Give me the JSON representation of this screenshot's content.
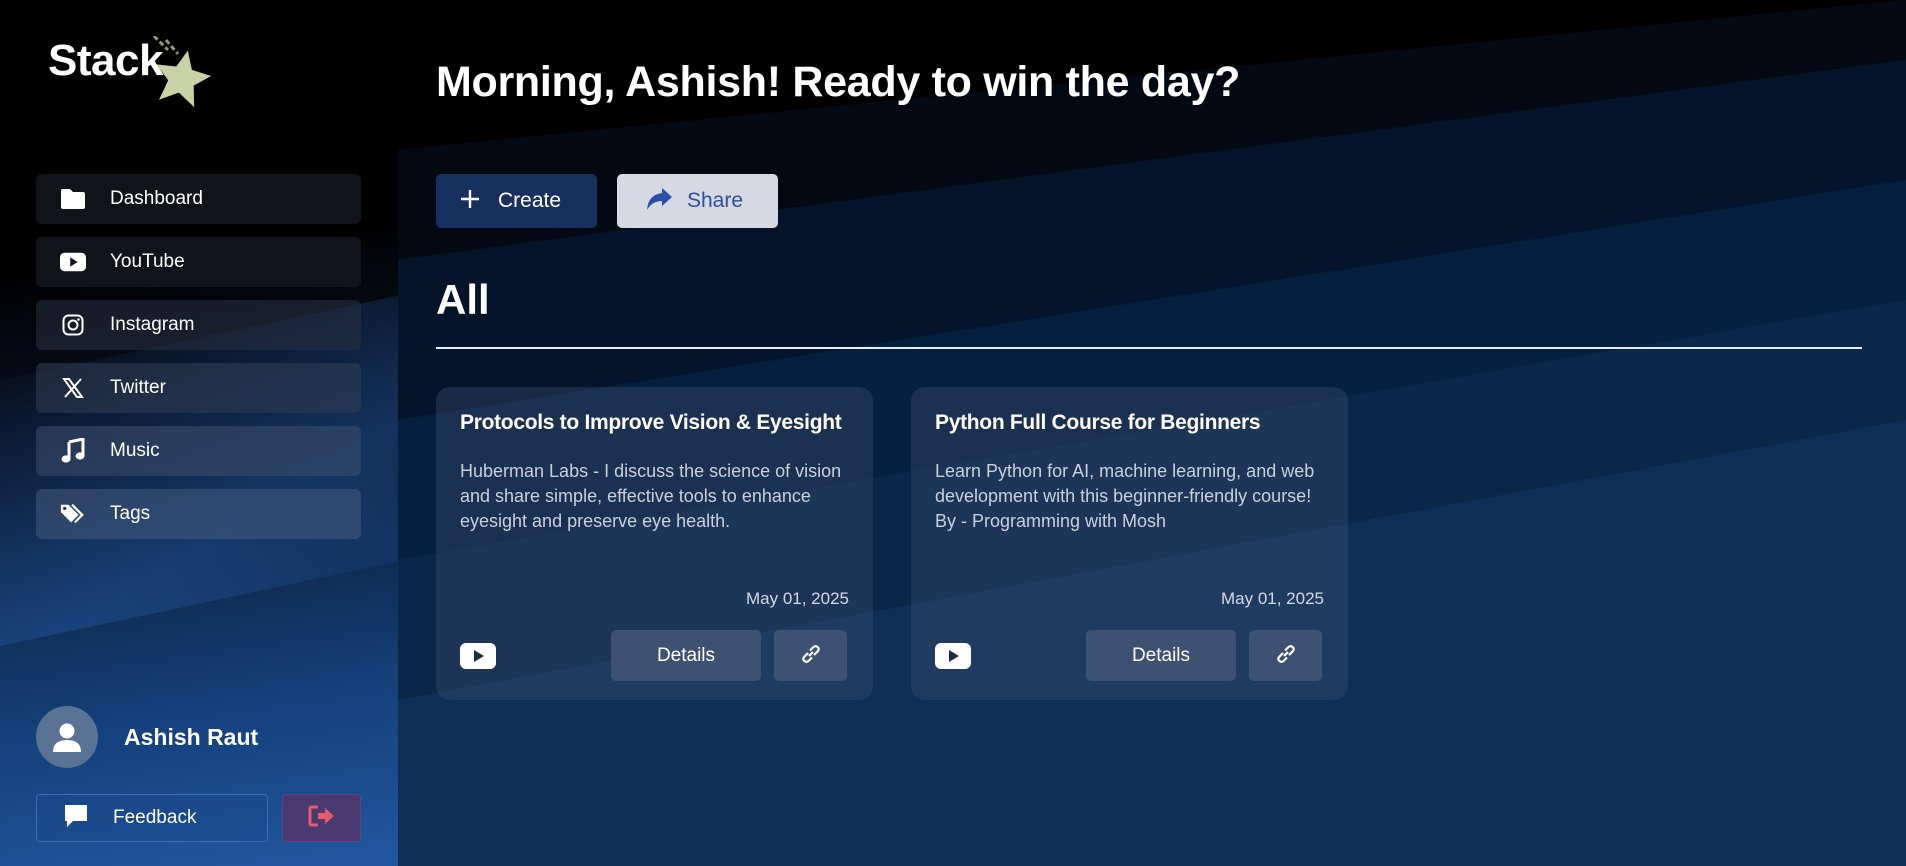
{
  "brand": {
    "name": "Stack"
  },
  "sidebar": {
    "items": [
      {
        "label": "Dashboard",
        "icon": "folder-icon"
      },
      {
        "label": "YouTube",
        "icon": "youtube-icon"
      },
      {
        "label": "Instagram",
        "icon": "instagram-icon"
      },
      {
        "label": "Twitter",
        "icon": "x-twitter-icon"
      },
      {
        "label": "Music",
        "icon": "music-note-icon"
      },
      {
        "label": "Tags",
        "icon": "tags-icon"
      }
    ],
    "user": {
      "name": "Ashish Raut",
      "avatar_icon": "user-avatar-icon"
    },
    "feedback_label": "Feedback",
    "logout_icon": "logout-icon"
  },
  "main": {
    "greeting": "Morning, Ashish! Ready to win the day?",
    "create_label": "Create",
    "share_label": "Share",
    "section_title": "All",
    "cards": [
      {
        "title": "Protocols to Improve Vision & Eyesight",
        "description": "Huberman Labs - I discuss the science of vision and share simple, effective tools to enhance eyesight and preserve eye health.",
        "date": "May 01, 2025",
        "details_label": "Details",
        "source_icon": "youtube-icon"
      },
      {
        "title": "Python Full Course for Beginners",
        "description": "Learn Python for AI, machine learning, and web development with this beginner-friendly course! By - Programming with Mosh",
        "date": "May 01, 2025",
        "details_label": "Details",
        "source_icon": "youtube-icon"
      }
    ]
  },
  "colors": {
    "accent_dark_blue": "#17305e",
    "share_bg": "#d5d9e4",
    "share_text": "#2b4fa8",
    "logout_icon": "#e8586e",
    "star": "#c9d2a4"
  }
}
